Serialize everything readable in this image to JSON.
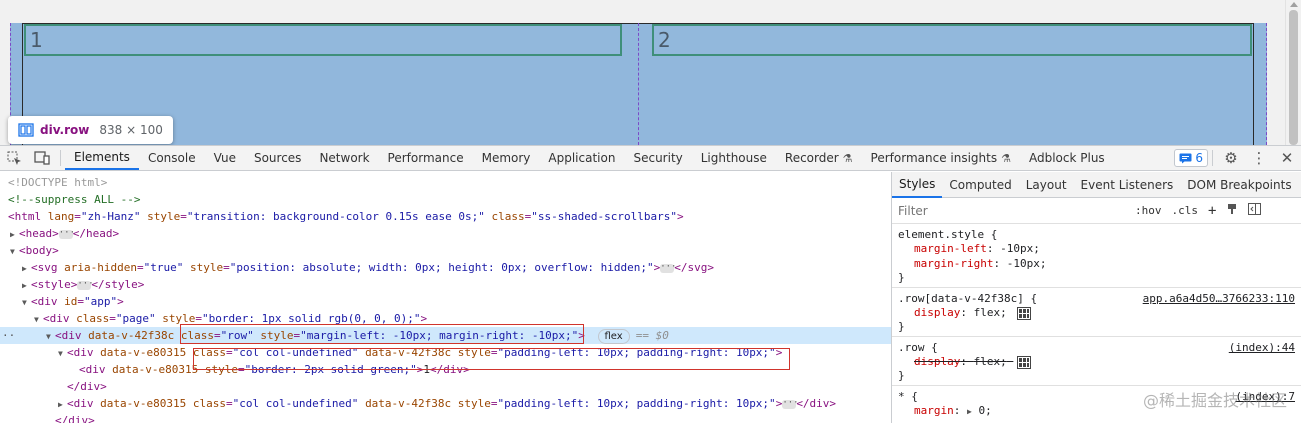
{
  "preview": {
    "col1_text": "1",
    "col2_text": "2",
    "tooltip": {
      "tag": "div.row",
      "dims": "838 × 100"
    }
  },
  "toolbar": {
    "tabs": [
      "Elements",
      "Console",
      "Vue",
      "Sources",
      "Network",
      "Performance",
      "Memory",
      "Application",
      "Security",
      "Lighthouse",
      "Recorder",
      "Performance insights",
      "Adblock Plus"
    ],
    "active_tab": "Elements",
    "badge_count": "6"
  },
  "elements": {
    "lines": [
      {
        "text1": "<!DOCTYPE html>"
      },
      {
        "text1": "<!--suppress ALL -->"
      },
      {
        "t_open": "<html",
        "a1": "lang",
        "v1": "\"zh-Hanz\"",
        "a2": "style",
        "v2": "\"transition: background-color 0.15s ease 0s;\"",
        "a3": "class",
        "v3": "\"ss-shaded-scrollbars\"",
        "t_close": ">"
      },
      {
        "t_open": "<head>",
        "t_close": "</head>"
      },
      {
        "t_open": "<body>"
      },
      {
        "t_open": "<svg",
        "a1": "aria-hidden",
        "v1": "\"true\"",
        "a2": "style",
        "v2": "\"position: absolute; width: 0px; height: 0px; overflow: hidden;\"",
        "t_close": ">",
        "t_end": "</svg>"
      },
      {
        "t_open": "<style>",
        "t_close": "</style>"
      },
      {
        "t_open": "<div",
        "a1": "id",
        "v1": "\"app\"",
        "t_close": ">"
      },
      {
        "t_open": "<div",
        "a1": "class",
        "v1": "\"page\"",
        "a2": "style",
        "v2": "\"border: 1px solid rgb(0, 0, 0);\"",
        "t_close": ">"
      },
      {
        "t_open": "<div",
        "a0": "data-v-42f38c",
        "a1": "class",
        "v1": "\"row\"",
        "a2": "style",
        "v2": "\"margin-left: -10px; margin-right: -10px;\"",
        "t_close": ">",
        "flex": "flex",
        "eq": "== $0"
      },
      {
        "t_open": "<div",
        "a0": "data-v-e80315",
        "a1": "class",
        "v1": "\"col col-undefined\"",
        "a0b": "data-v-42f38c",
        "a2": "style",
        "v2": "\"padding-left: 10px; padding-right: 10px;\"",
        "t_close": ">"
      },
      {
        "t_open": "<div",
        "a0": "data-v-e80315",
        "a2": "style",
        "v2": "\"border: 2px solid green;\"",
        "t_close": ">",
        "txt": "1",
        "t_end": "</div>"
      },
      {
        "t_end": "</div>"
      },
      {
        "t_open": "<div",
        "a0": "data-v-e80315",
        "a1": "class",
        "v1": "\"col col-undefined\"",
        "a0b": "data-v-42f38c",
        "a2": "style",
        "v2": "\"padding-left: 10px; padding-right: 10px;\"",
        "t_close": ">",
        "t_end": "</div>"
      },
      {
        "t_end": "</div>"
      }
    ]
  },
  "styles": {
    "subtabs": [
      "Styles",
      "Computed",
      "Layout",
      "Event Listeners",
      "DOM Breakpoints"
    ],
    "filter_placeholder": "Filter",
    "hov": ":hov",
    "cls": ".cls",
    "rules": [
      {
        "selector": "element.style {",
        "decls": [
          {
            "prop": "margin-left",
            "val": "-10px;"
          },
          {
            "prop": "margin-right",
            "val": "-10px;"
          }
        ],
        "close": "}"
      },
      {
        "selector": ".row[data-v-42f38c] {",
        "source": "app.a6a4d50…3766233:110",
        "decls": [
          {
            "prop": "display",
            "val": "flex;"
          }
        ],
        "close": "}"
      },
      {
        "selector": ".row {",
        "source": "(index):44",
        "decls": [
          {
            "prop": "display",
            "val": "flex;"
          }
        ],
        "close": "}"
      },
      {
        "selector": "* {",
        "source": "(index):7",
        "decls": [
          {
            "prop": "margin",
            "val": "0;"
          }
        ]
      }
    ],
    "watermark": "@稀土掘金技术社区"
  }
}
